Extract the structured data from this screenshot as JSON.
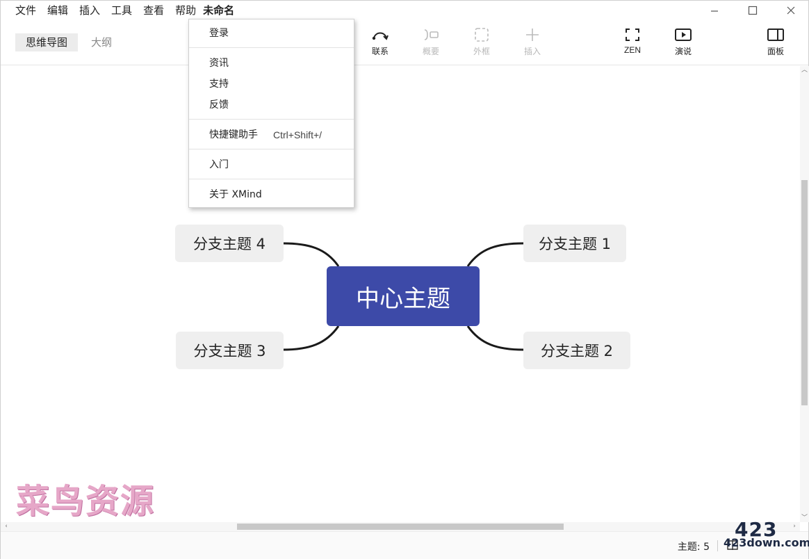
{
  "menubar": {
    "items": [
      "文件",
      "编辑",
      "插入",
      "工具",
      "查看",
      "帮助"
    ],
    "doc_title": "未命名"
  },
  "window_controls": {
    "minimize": "—",
    "maximize": "☐",
    "close": "✕"
  },
  "toolbar": {
    "tabs": [
      {
        "label": "思维导图",
        "selected": true
      },
      {
        "label": "大纲",
        "selected": false
      }
    ],
    "tools": [
      {
        "label": "联系",
        "icon": "relationship-icon",
        "enabled": true
      },
      {
        "label": "概要",
        "icon": "summary-icon",
        "enabled": false
      },
      {
        "label": "外框",
        "icon": "boundary-icon",
        "enabled": false
      },
      {
        "label": "插入",
        "icon": "plus-icon",
        "enabled": false
      },
      {
        "label": "ZEN",
        "icon": "fullscreen-icon",
        "enabled": true
      },
      {
        "label": "演说",
        "icon": "play-icon",
        "enabled": true
      },
      {
        "label": "面板",
        "icon": "panel-icon",
        "enabled": true
      }
    ]
  },
  "help_menu": {
    "items": [
      {
        "label": "登录"
      },
      {
        "label": "资讯"
      },
      {
        "label": "支持"
      },
      {
        "label": "反馈"
      },
      {
        "label": "快捷键助手",
        "shortcut": "Ctrl+Shift+/"
      },
      {
        "label": "入门"
      },
      {
        "label": "关于 XMind"
      }
    ]
  },
  "mindmap": {
    "central": "中心主题",
    "branches": [
      "分支主题 1",
      "分支主题 2",
      "分支主题 3",
      "分支主题 4"
    ],
    "colors": {
      "central": "#3d4aa8",
      "branch": "#efefef",
      "line": "#1a1a1a"
    }
  },
  "statusbar": {
    "topic_count": "主题: 5"
  },
  "watermarks": {
    "left": "菜鸟资源",
    "right_big": "423",
    "right_small": "423down.com"
  }
}
